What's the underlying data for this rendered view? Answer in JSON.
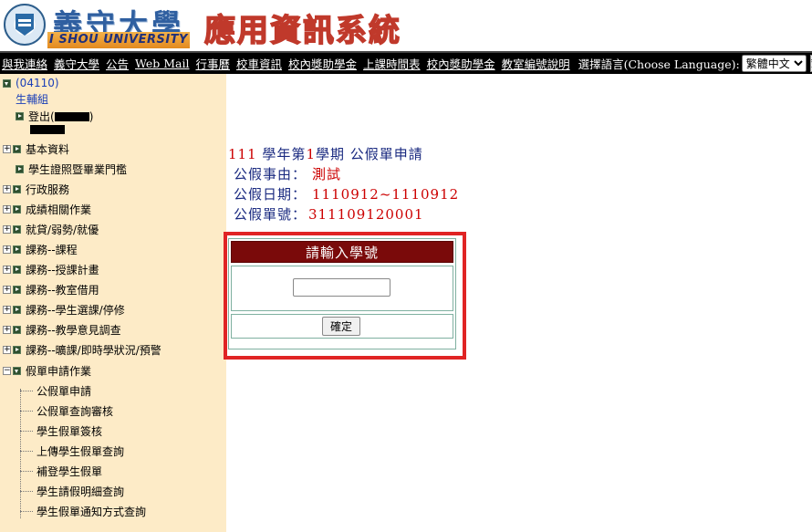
{
  "header": {
    "university_cn": "義守大學",
    "university_en": "I SHOU UNIVERSITY",
    "system_title": "應用資訊系統",
    "seal_text": "ISU"
  },
  "topnav": {
    "links": [
      "與我連絡",
      "義守大學",
      "公告",
      "Web Mail",
      "行事曆",
      "校車資訊",
      "校內獎助學金",
      "上課時間表",
      "校內獎助學金",
      "教室編號說明"
    ],
    "language_label": "選擇語言(Choose Language):",
    "language_selected": "繁體中文",
    "extra_button": "繁"
  },
  "sidebar": {
    "root_label": "(04110)",
    "group_label": "生輔組",
    "logout_prefix": "登出(",
    "logout_suffix": ")",
    "menus": [
      {
        "label": "基本資料",
        "expandable": true
      },
      {
        "label": "學生證照暨畢業門檻",
        "expandable": false
      },
      {
        "label": "行政服務",
        "expandable": true
      },
      {
        "label": "成績相關作業",
        "expandable": true
      },
      {
        "label": "就貸/弱勢/就優",
        "expandable": true
      },
      {
        "label": "課務--課程",
        "expandable": true
      },
      {
        "label": "課務--授課計畫",
        "expandable": true
      },
      {
        "label": "課務--教室借用",
        "expandable": true
      },
      {
        "label": "課務--學生選課/停修",
        "expandable": true
      },
      {
        "label": "課務--教學意見調查",
        "expandable": true
      },
      {
        "label": "課務--曠課/即時學狀況/預警",
        "expandable": true
      },
      {
        "label": "假單申請作業",
        "expandable": true,
        "open": true
      }
    ],
    "leaves": [
      "公假單申請",
      "公假單查詢審核",
      "學生假單簽核",
      "上傳學生假單查詢",
      "補登學生假單",
      "學生請假明細查詢",
      "學生假單通知方式查詢"
    ]
  },
  "main": {
    "year": "111",
    "year_label": "學年第",
    "term": "1",
    "term_label": "學期 公假單申請",
    "reason_label": "公假事由：",
    "reason_value": "測試",
    "date_label": "公假日期：",
    "date_value": "1110912~1110912",
    "number_label": "公假單號：",
    "number_value": "311109120001",
    "form_title": "請輸入學號",
    "student_id_value": "",
    "confirm_label": "確定"
  },
  "colors": {
    "sidebar_bg": "#fdebc7",
    "nav_bg": "#000000",
    "form_header_bg": "#7a0a0a",
    "highlight_border": "#e02424"
  }
}
